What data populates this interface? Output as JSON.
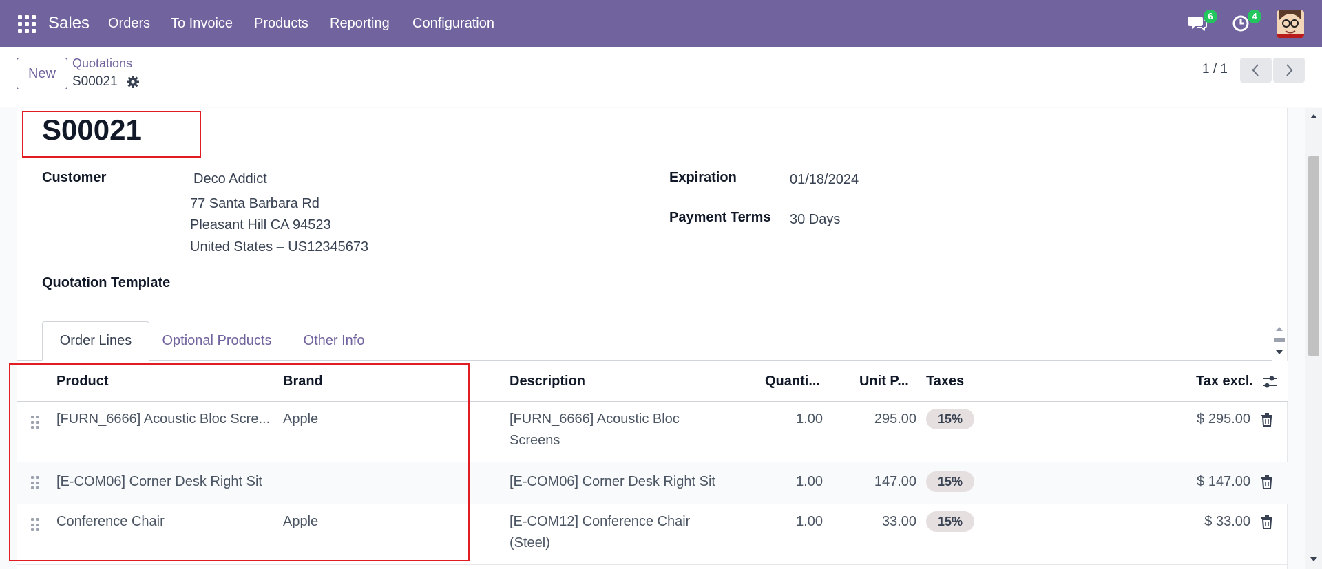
{
  "navbar": {
    "brand": "Sales",
    "menu": [
      "Orders",
      "To Invoice",
      "Products",
      "Reporting",
      "Configuration"
    ],
    "chat_count": "6",
    "activity_count": "4"
  },
  "control": {
    "new_label": "New",
    "breadcrumb_parent": "Quotations",
    "breadcrumb_current": "S00021",
    "pager": "1 / 1"
  },
  "form": {
    "title": "S00021",
    "customer_label": "Customer",
    "customer_name": "Deco Addict",
    "address": [
      "77 Santa Barbara Rd",
      "Pleasant Hill CA 94523",
      "United States – US12345673"
    ],
    "expiration_label": "Expiration",
    "expiration_value": "01/18/2024",
    "payment_terms_label": "Payment Terms",
    "payment_terms_value": "30 Days",
    "template_label": "Quotation Template"
  },
  "tabs": [
    "Order Lines",
    "Optional Products",
    "Other Info"
  ],
  "table": {
    "columns": [
      "Product",
      "Brand",
      "Description",
      "Quanti...",
      "Unit P...",
      "Taxes",
      "Tax excl."
    ],
    "rows": [
      {
        "product": "[FURN_6666] Acoustic Bloc Scre...",
        "brand": "Apple",
        "desc1": "[FURN_6666] Acoustic Bloc",
        "desc2": "Screens",
        "qty": "1.00",
        "price": "295.00",
        "tax": "15%",
        "subtotal": "$ 295.00"
      },
      {
        "product": "[E-COM06] Corner Desk Right Sit",
        "brand": "",
        "desc1": "[E-COM06] Corner Desk Right Sit",
        "desc2": "",
        "qty": "1.00",
        "price": "147.00",
        "tax": "15%",
        "subtotal": "$ 147.00"
      },
      {
        "product": "Conference Chair",
        "brand": "Apple",
        "desc1": "[E-COM12] Conference Chair",
        "desc2": "(Steel)",
        "qty": "1.00",
        "price": "33.00",
        "tax": "15%",
        "subtotal": "$ 33.00"
      }
    ]
  },
  "colors": {
    "brand": "#71639e",
    "highlight": "#e11d24",
    "badge": "#22c55e"
  },
  "icons": [
    "apps-grid-icon",
    "chat-icon",
    "activity-clock-icon",
    "gear-icon",
    "chevron-left-icon",
    "chevron-right-icon",
    "drag-handle-icon",
    "trash-icon",
    "column-settings-icon"
  ]
}
